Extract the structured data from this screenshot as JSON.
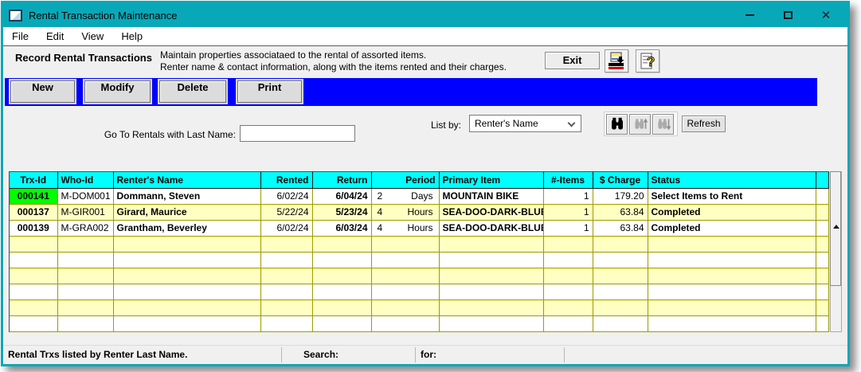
{
  "window": {
    "title": "Rental Transaction Maintenance",
    "close_glyph": "✕"
  },
  "menu": {
    "items": [
      "File",
      "Edit",
      "View",
      "Help"
    ]
  },
  "header": {
    "title": "Record Rental Transactions",
    "description_line1": "Maintain properties associataed to the rental of assorted items.",
    "description_line2": "Renter name & contact information, along with the items rented and their charges.",
    "exit_label": "Exit"
  },
  "action_bar": {
    "new": "New",
    "modify": "Modify",
    "delete": "Delete",
    "print": "Print"
  },
  "filter": {
    "goto_label": "Go To Rentals with Last Name:",
    "goto_value": "",
    "listby_label": "List by:",
    "listby_selected": "Renter's Name",
    "refresh_label": "Refresh"
  },
  "table": {
    "columns": [
      "Trx-Id",
      "Who-Id",
      "Renter's Name",
      "Rented",
      "Return",
      "Period",
      "Primary Item",
      "#-Items",
      "$ Charge",
      "Status"
    ],
    "rows": [
      {
        "trx_id": "000141",
        "who_id": "M-DOM001",
        "renter_name": "Dommann, Steven",
        "rented": "6/02/24",
        "return": "6/04/24",
        "period_qty": "2",
        "period_unit": "Days",
        "primary_item": "MOUNTAIN BIKE",
        "num_items": "1",
        "charge": "179.20",
        "status": "Select Items to Rent",
        "selected": true
      },
      {
        "trx_id": "000137",
        "who_id": "M-GIR001",
        "renter_name": "Girard, Maurice",
        "rented": "5/22/24",
        "return": "5/23/24",
        "period_qty": "4",
        "period_unit": "Hours",
        "primary_item": "SEA-DOO-DARK-BLUE",
        "num_items": "1",
        "charge": "63.84",
        "status": "Completed",
        "selected": false
      },
      {
        "trx_id": "000139",
        "who_id": "M-GRA002",
        "renter_name": "Grantham, Beverley",
        "rented": "6/02/24",
        "return": "6/03/24",
        "period_qty": "4",
        "period_unit": "Hours",
        "primary_item": "SEA-DOO-DARK-BLUE",
        "num_items": "1",
        "charge": "63.84",
        "status": "Completed",
        "selected": false
      }
    ],
    "empty_rows": 6
  },
  "status_bar": {
    "message": "Rental Trxs listed by Renter Last Name.",
    "search_label": "Search:",
    "for_label": "for:"
  },
  "colors": {
    "titlebar_teal": "#09A8B8",
    "action_bar_blue": "#0000FF",
    "grid_header_cyan": "#00FFFF",
    "selected_cell_green": "#00FF00",
    "row_highlight_yellow": "#FFFFC2",
    "grid_line_olive": "#9C9C00"
  }
}
